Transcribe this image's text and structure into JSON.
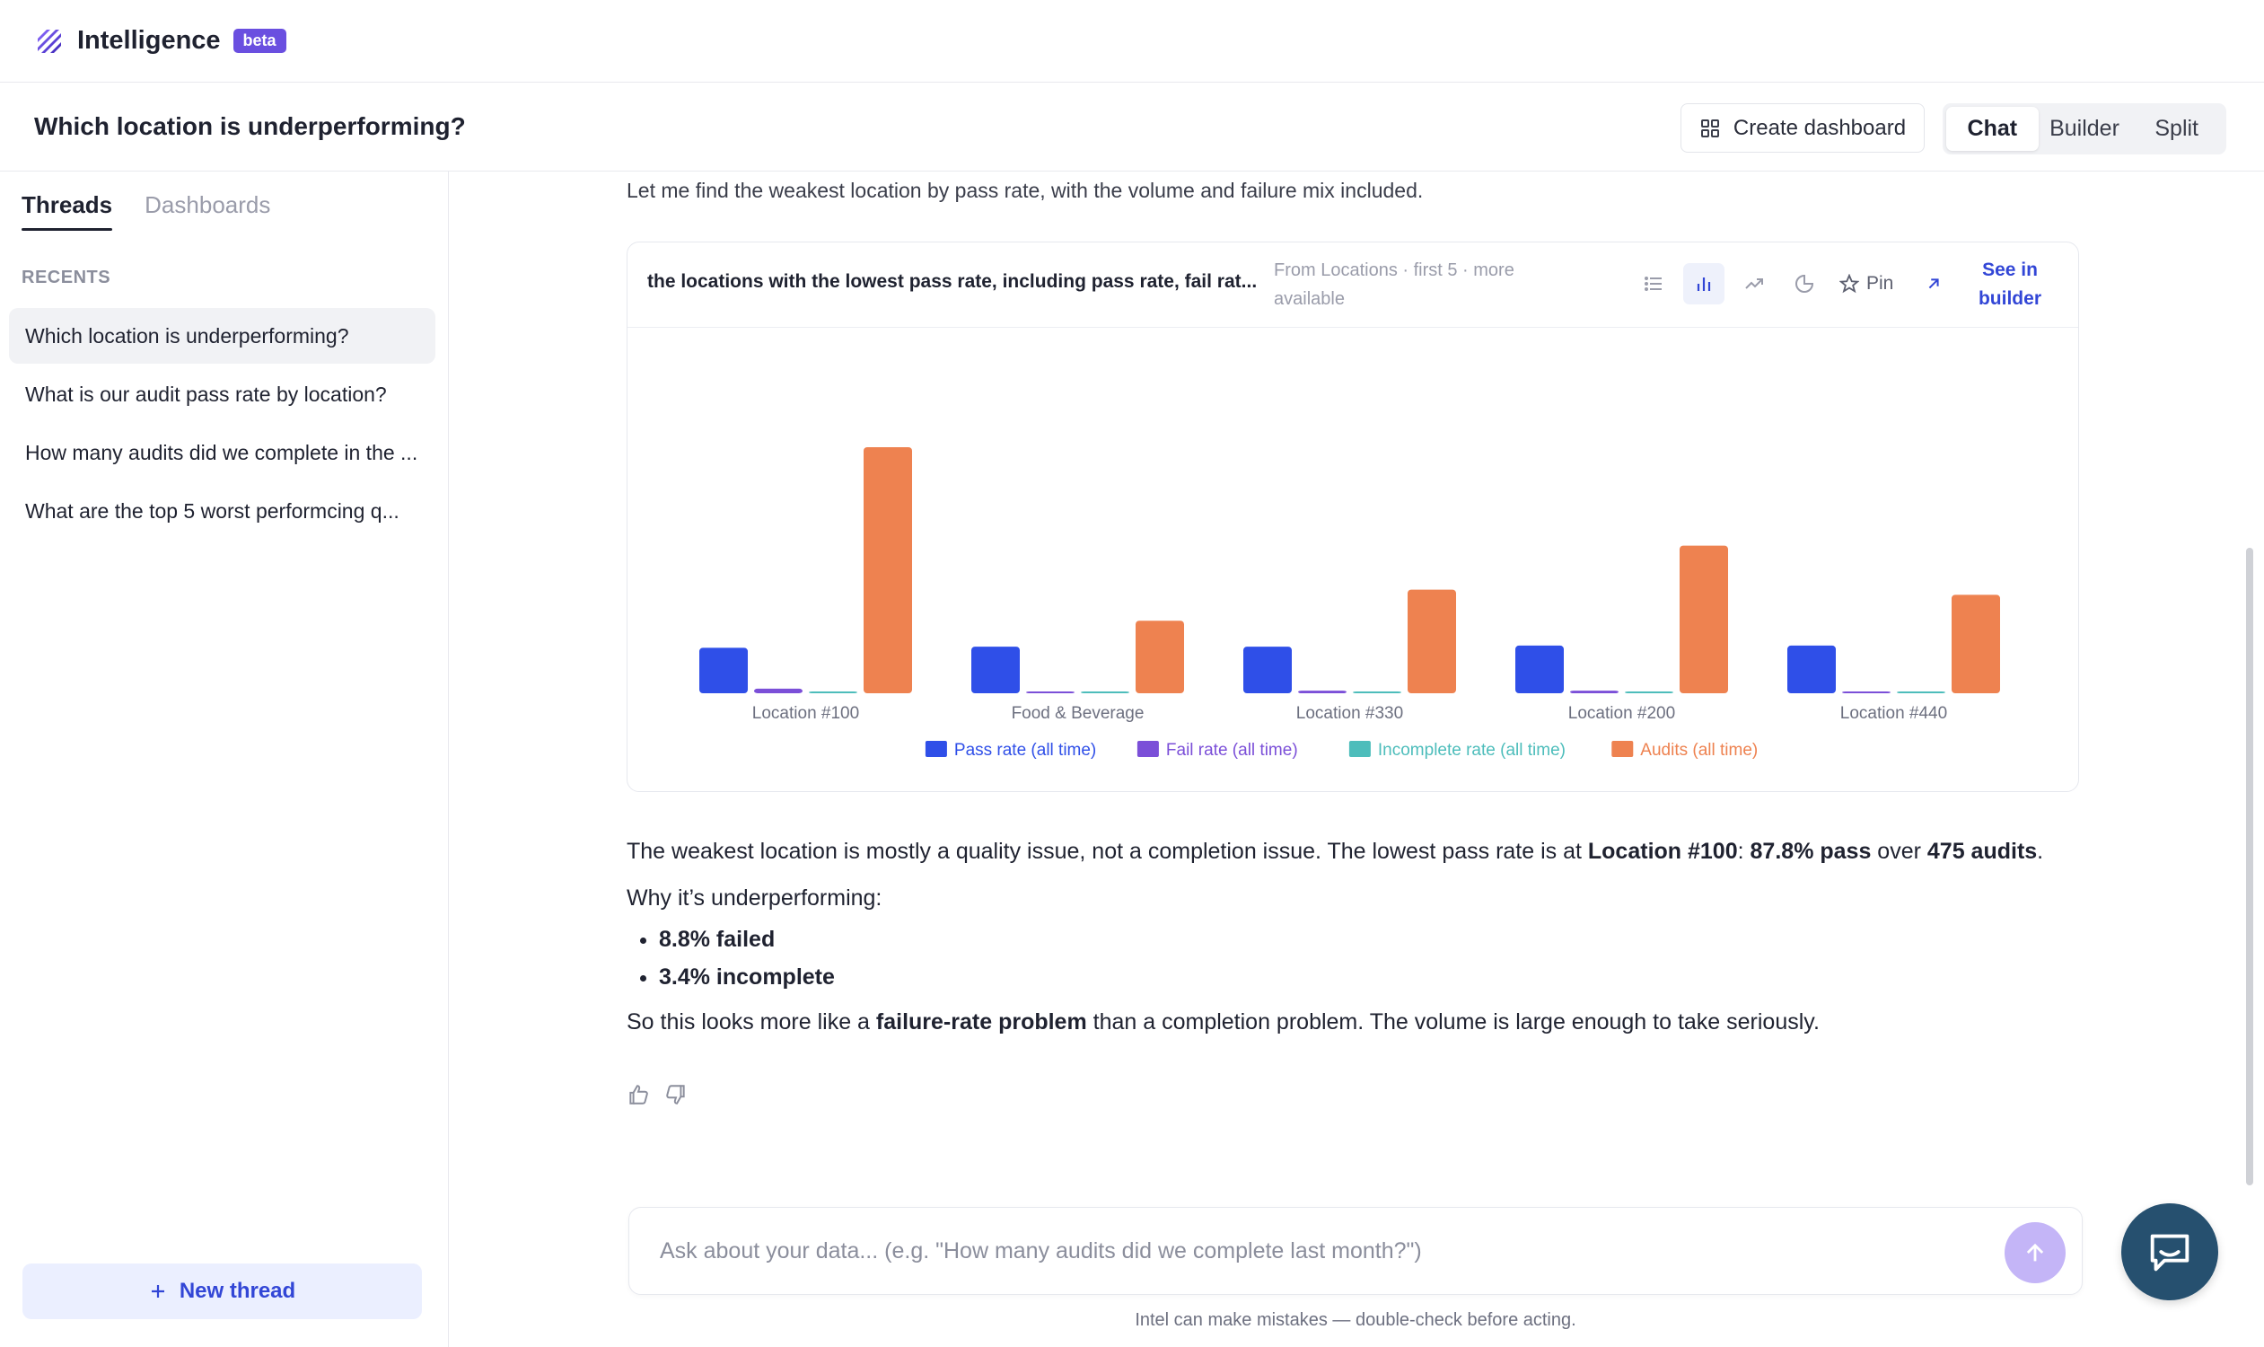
{
  "app": {
    "title": "Intelligence",
    "badge": "beta"
  },
  "header": {
    "page_title": "Which location is underperforming?",
    "create_dashboard_label": "Create dashboard",
    "view_options": [
      "Chat",
      "Builder",
      "Split"
    ],
    "active_view": "Chat"
  },
  "sidebar": {
    "tabs": [
      "Threads",
      "Dashboards"
    ],
    "active_tab": "Threads",
    "recents_label": "RECENTS",
    "threads": [
      "Which location is underperforming?",
      "What is our audit pass rate by location?",
      "How many audits did we complete in the ...",
      "What are the top 5 worst performcing q..."
    ],
    "new_thread_label": "New thread"
  },
  "main": {
    "intro": "Let me find the weakest location by pass rate, with the volume and failure mix included.",
    "card": {
      "question": "the locations with the lowest pass rate, including pass rate, fail rat...",
      "source": "From Locations · first 5 · more available",
      "pin_label": "Pin",
      "see_builder_label": "See in builder"
    },
    "answer": {
      "p1_text": "The weakest location is mostly a quality issue, not a completion issue. The lowest pass rate is at ",
      "p1_b1": "Location #100",
      "p1_mid1": ": ",
      "p1_b2": "87.8% pass",
      "p1_mid2": " over ",
      "p1_b3": "475 audits",
      "p1_end": ".",
      "p2": "Why it’s underperforming:",
      "bullets": [
        "8.8% failed",
        "3.4% incomplete"
      ],
      "p3_start": "So this looks more like a ",
      "p3_b": "failure-rate problem",
      "p3_end": " than a completion problem. The volume is large enough to take seriously."
    },
    "composer": {
      "placeholder": "Ask about your data... (e.g. \"How many audits did we complete last month?\")"
    },
    "disclaimer": "Intel can make mistakes — double-check before acting."
  },
  "colors": {
    "accent": "#3246d6",
    "beta": "#6a4fe0",
    "pass": "#2f4fe8",
    "fail": "#7b4fd8",
    "incomplete": "#4dbdbb",
    "audits": "#ee8250"
  },
  "chart_data": {
    "type": "bar",
    "categories": [
      "Location #100",
      "Food & Beverage",
      "Location #330",
      "Location #200",
      "Location #440"
    ],
    "series": [
      {
        "name": "Pass rate (all time)",
        "color": "#2f4fe8",
        "values": [
          87.8,
          90,
          90,
          92,
          92
        ]
      },
      {
        "name": "Fail rate (all time)",
        "color": "#7b4fd8",
        "values": [
          8.8,
          1,
          5,
          5,
          3
        ]
      },
      {
        "name": "Incomplete rate (all time)",
        "color": "#4dbdbb",
        "values": [
          3.4,
          3,
          2,
          1,
          2
        ]
      },
      {
        "name": "Audits (all time)",
        "color": "#ee8250",
        "values": [
          475,
          140,
          200,
          285,
          190
        ]
      }
    ],
    "ylim": [
      0,
      520
    ],
    "legend": "bottom-center",
    "grid": false
  }
}
